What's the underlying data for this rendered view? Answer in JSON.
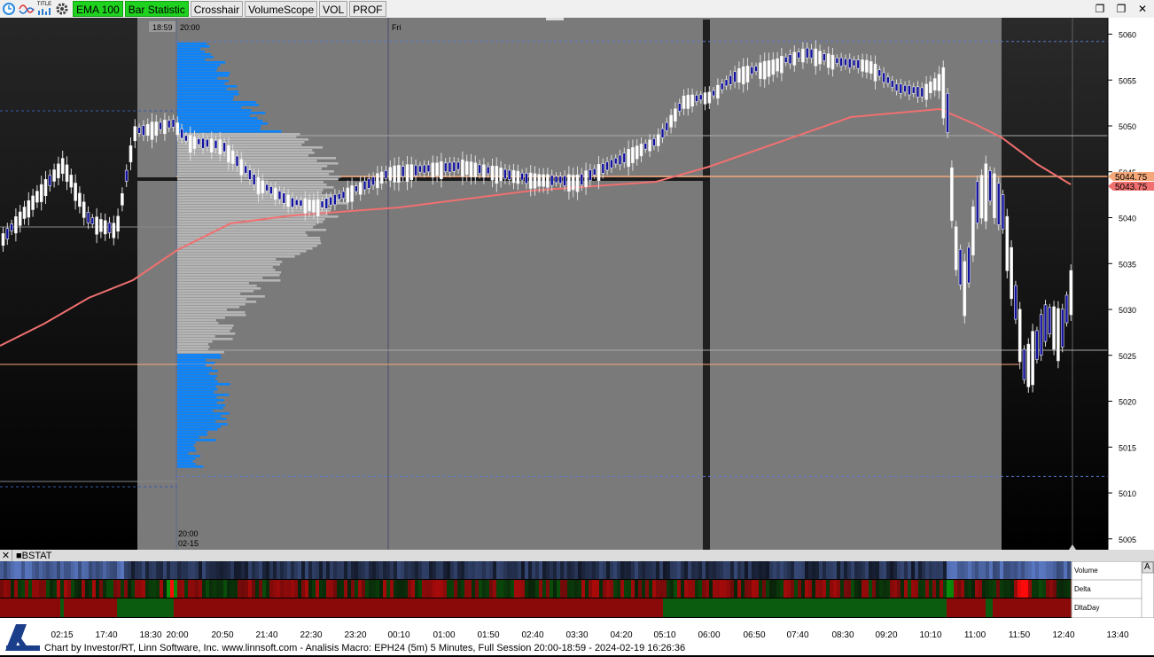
{
  "toolbar": {
    "title_icon_label": "TITLE",
    "buttons": [
      {
        "label": "EMA 100",
        "active": true
      },
      {
        "label": "Bar Statistic",
        "active": true
      },
      {
        "label": "Crosshair",
        "active": false
      },
      {
        "label": "VolumeScope",
        "active": false
      },
      {
        "label": "VOL",
        "active": false
      },
      {
        "label": "PROF",
        "active": false
      }
    ]
  },
  "window_controls": [
    "restore-icon",
    "restore-icon",
    "close-icon"
  ],
  "chart": {
    "session_start_time": "18:59",
    "session_label": "20:00",
    "day_marker": "Fri",
    "bottom_left_time": "20:00",
    "bottom_left_date": "02-15",
    "price_axis": [
      "5060",
      "5055",
      "5050",
      "5045",
      "5040",
      "5035",
      "5030",
      "5025",
      "5020",
      "5015",
      "5010",
      "5005"
    ],
    "ema_price_label": "5044.75",
    "last_price_label": "5043.75",
    "colors": {
      "ema": "#f07070",
      "profile_highlight": "#0a84ff",
      "profile_value": "#b5b5b5",
      "price_marker": "#f5a87a",
      "session_bg": "#7a7a7a"
    }
  },
  "bstat": {
    "panel_title": "BSTAT",
    "rows": [
      "Volume",
      "Delta",
      "DltaDay"
    ],
    "corner_button": "A"
  },
  "time_axis": [
    "02:15",
    "17:40",
    "18:30",
    "20:00",
    "20:50",
    "21:40",
    "22:30",
    "23:20",
    "00:10",
    "01:00",
    "01:50",
    "02:40",
    "03:30",
    "04:20",
    "05:10",
    "06:00",
    "06:50",
    "07:40",
    "08:30",
    "09:20",
    "10:10",
    "11:00",
    "11:50",
    "12:40",
    "13:40"
  ],
  "footer": {
    "text": "Chart by Investor/RT, Linn Software, Inc. www.linnsoft.com - Analisis Macro: EPH24 (5m) 5 Minutes, Full Session 20:00-18:59 - 2024-02-19 16:26:36"
  }
}
